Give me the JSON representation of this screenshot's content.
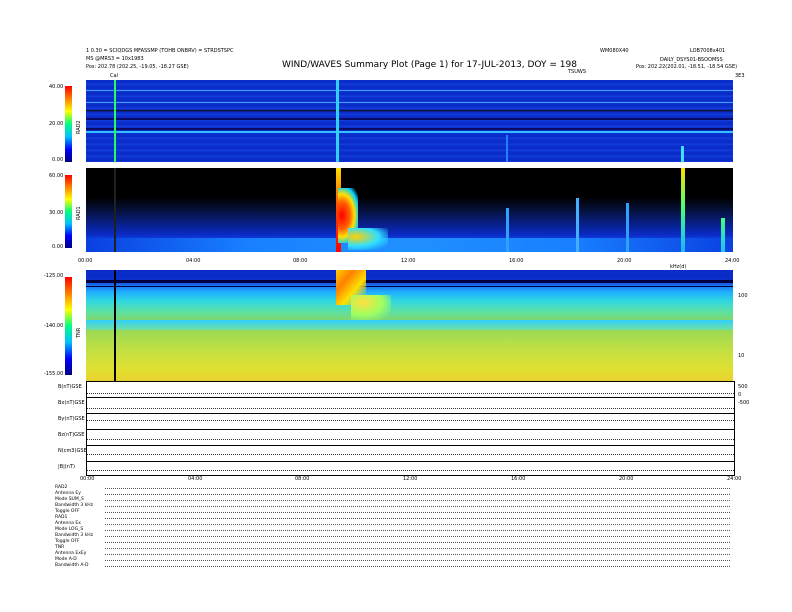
{
  "header": {
    "left_lines": [
      "1 0.30 = SCIQDGS MFASSMP (TOHB ONBRV) = STRDSTSPC",
      "MS @MRS3 = 10x1983",
      "Pos: 202.78 (202.25, -19.05, -18.27 GSE)"
    ],
    "title": "WIND/WAVES Summary Plot (Page 1) for 17-JUL-2013, DOY = 198",
    "center_right": "WM080X40",
    "right_lines": [
      "LOB7008x401",
      "DAILY_DSYS01-BSOOMSS",
      "Pos: 202.22(202.01, -18.51, -18.54 GSE)"
    ],
    "sub_labels": [
      "Cal",
      "TSUWS",
      "3E3"
    ]
  },
  "colors": {
    "background": "#ffffff",
    "spec_blue": "#0a2cc8",
    "black_bg": "#000000",
    "tnr_green": "#8cd45a"
  },
  "chart_data": [
    {
      "type": "heatmap",
      "panel": "RAD2",
      "ylabel": "RAD2",
      "y_ticks": [
        "40.00",
        "20.00",
        "0.00"
      ],
      "ylim": [
        0,
        40
      ],
      "colorbar": true
    },
    {
      "type": "heatmap",
      "panel": "RAD1",
      "ylabel": "RAD1",
      "y_ticks": [
        "60.00",
        "30.00",
        "0.00"
      ],
      "ylim": [
        0,
        60
      ],
      "x_ticks": [
        "00:00",
        "04:00",
        "08:00",
        "12:00",
        "16:00",
        "20:00",
        "24:00"
      ],
      "colorbar": true
    },
    {
      "type": "heatmap",
      "panel": "TNR",
      "ylabel": "TNR",
      "y_ticks": [
        "-125.00",
        "-140.00",
        "-155.00"
      ],
      "ylim": [
        -155,
        -125
      ],
      "right_ticks": [
        "100",
        "10"
      ],
      "right_label": "kHz(d)",
      "colorbar": true
    },
    {
      "type": "line",
      "panel": "lower-strips",
      "strips": [
        "B(nT)GSE",
        "Bx(nT)GSE",
        "By(nT)GSE",
        "Bz(nT)GSE",
        "N(cm3)GSE",
        "|B|(nT)"
      ],
      "x_ticks": [
        "00:00",
        "04:00",
        "08:00",
        "12:00",
        "16:00",
        "20:00",
        "24:00"
      ],
      "right_ticks": [
        "500",
        "0",
        "-500"
      ]
    }
  ],
  "params": [
    {
      "name": "RAD2",
      "value": ""
    },
    {
      "name": "Antenna",
      "value": "Ey"
    },
    {
      "name": "Mode",
      "value": "SUM_S"
    },
    {
      "name": "Bandwidth",
      "value": "3 kHz"
    },
    {
      "name": "Toggle",
      "value": "OFF"
    },
    {
      "name": "RAD1",
      "value": ""
    },
    {
      "name": "Antenna",
      "value": "Ex"
    },
    {
      "name": "Mode",
      "value": "LOG_S"
    },
    {
      "name": "Bandwidth",
      "value": "3 kHz"
    },
    {
      "name": "Toggle",
      "value": "OFF"
    },
    {
      "name": "TNR",
      "value": ""
    },
    {
      "name": "Antenna",
      "value": "ExEy"
    },
    {
      "name": "Mode",
      "value": "A-D"
    },
    {
      "name": "Bandwidth",
      "value": "A-D"
    }
  ]
}
